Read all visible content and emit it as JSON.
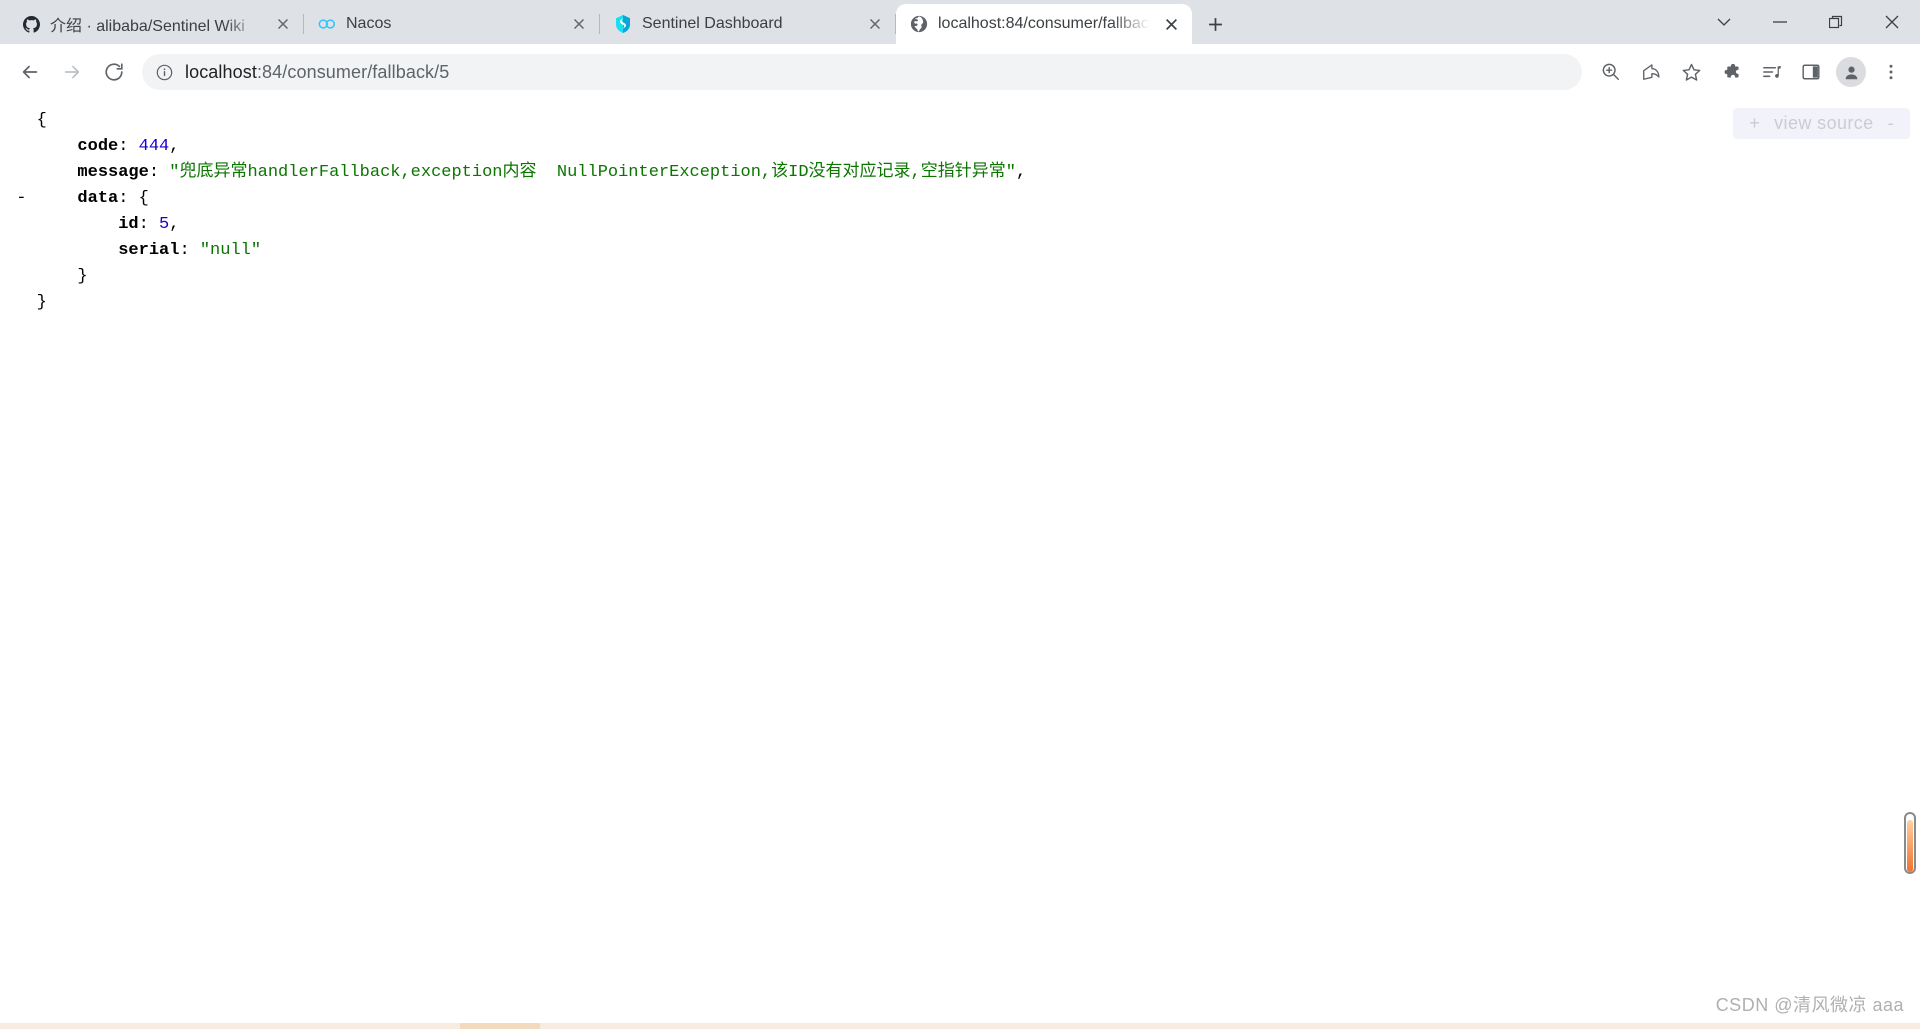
{
  "window": {
    "controls": [
      {
        "name": "tab-search",
        "icon": "chevron-down-icon",
        "label": ""
      },
      {
        "name": "minimize",
        "icon": "minimize-icon",
        "label": ""
      },
      {
        "name": "maximize",
        "icon": "restore-icon",
        "label": ""
      },
      {
        "name": "close",
        "icon": "close-icon",
        "label": ""
      }
    ]
  },
  "tabs": [
    {
      "title": "介绍 · alibaba/Sentinel Wiki",
      "favicon": "github-icon",
      "active": false
    },
    {
      "title": "Nacos",
      "favicon": "nacos-icon",
      "active": false
    },
    {
      "title": "Sentinel Dashboard",
      "favicon": "sentinel-icon",
      "active": false
    },
    {
      "title": "localhost:84/consumer/fallbac",
      "favicon": "globe-icon",
      "active": true
    }
  ],
  "newtab_label": "+",
  "toolbar": {
    "back_label": "←",
    "forward_label": "→",
    "reload_label": "⟳",
    "site_info_icon": "info-circle-icon",
    "url_host": "localhost",
    "url_path": ":84/consumer/fallback/5",
    "url_full": "localhost:84/consumer/fallback/5",
    "icons": [
      {
        "name": "zoom-in-icon",
        "label": ""
      },
      {
        "name": "share-icon",
        "label": ""
      },
      {
        "name": "bookmark-star-icon",
        "label": ""
      },
      {
        "name": "extensions-puzzle-icon",
        "label": ""
      },
      {
        "name": "media-playlist-icon",
        "label": ""
      },
      {
        "name": "side-panel-icon",
        "label": ""
      },
      {
        "name": "profile-avatar-icon",
        "label": ""
      },
      {
        "name": "chrome-menu-icon",
        "label": "⋮"
      }
    ]
  },
  "page": {
    "view_source": {
      "plus": "+",
      "label": "view source",
      "minus": "-"
    },
    "json": {
      "open_brace": "{",
      "close_brace": "}",
      "lines": [
        {
          "indent": 0,
          "collapser": "",
          "key": "",
          "sep": "",
          "value": "{",
          "vtype": "punct",
          "comma": ""
        },
        {
          "indent": 1,
          "collapser": "",
          "key": "code",
          "sep": ": ",
          "value": "444",
          "vtype": "number",
          "comma": ","
        },
        {
          "indent": 1,
          "collapser": "",
          "key": "message",
          "sep": ": ",
          "value": "\"兜底异常handlerFallback,exception内容  NullPointerException,该ID没有对应记录,空指针异常\"",
          "vtype": "string",
          "comma": ","
        },
        {
          "indent": 1,
          "collapser": "-",
          "key": "data",
          "sep": ": ",
          "value": "{",
          "vtype": "punct",
          "comma": ""
        },
        {
          "indent": 2,
          "collapser": "",
          "key": "id",
          "sep": ": ",
          "value": "5",
          "vtype": "number",
          "comma": ","
        },
        {
          "indent": 2,
          "collapser": "",
          "key": "serial",
          "sep": ": ",
          "value": "\"null\"",
          "vtype": "string",
          "comma": ""
        },
        {
          "indent": 1,
          "collapser": "",
          "key": "",
          "sep": "",
          "value": "}",
          "vtype": "punct",
          "comma": ""
        },
        {
          "indent": 0,
          "collapser": "",
          "key": "",
          "sep": "",
          "value": "}",
          "vtype": "punct",
          "comma": ""
        }
      ]
    },
    "watermark": "CSDN @清风微凉 aaa"
  },
  "colors": {
    "tabstrip_bg": "#dee1e6",
    "active_tab_bg": "#ffffff",
    "omnibox_bg": "#f1f3f4",
    "json_number": "#1a01cc",
    "json_string": "#0b7500",
    "json_key": "#000000",
    "scroll_accent": "#f2712c",
    "view_source_text": "#c9cbd6"
  }
}
